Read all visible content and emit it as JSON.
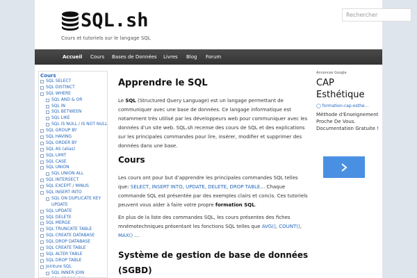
{
  "header": {
    "logo_text": "SQL.sh",
    "tagline": "Cours et tutoriels sur le langage SQL",
    "search_placeholder": "Rechercher"
  },
  "nav": [
    "Accueil",
    "Cours",
    "Bases de Données",
    "Livres",
    "Blog",
    "Forum"
  ],
  "sidebar": {
    "heading": "Cours",
    "items": [
      {
        "label": "SQL SELECT",
        "level": 1
      },
      {
        "label": "SQL DISTINCT",
        "level": 1
      },
      {
        "label": "SQL WHERE",
        "level": 1
      },
      {
        "label": "SQL AND & OR",
        "level": 2
      },
      {
        "label": "SQL IN",
        "level": 2
      },
      {
        "label": "SQL BETWEEN",
        "level": 2
      },
      {
        "label": "SQL LIKE",
        "level": 2
      },
      {
        "label": "SQL IS NULL / IS NOT NULL",
        "level": 2
      },
      {
        "label": "SQL GROUP BY",
        "level": 1
      },
      {
        "label": "SQL HAVING",
        "level": 1
      },
      {
        "label": "SQL ORDER BY",
        "level": 1
      },
      {
        "label": "SQL AS (alias)",
        "level": 1
      },
      {
        "label": "SQL LIMIT",
        "level": 1
      },
      {
        "label": "SQL CASE",
        "level": 1
      },
      {
        "label": "SQL UNION",
        "level": 1
      },
      {
        "label": "SQL UNION ALL",
        "level": 2
      },
      {
        "label": "SQL INTERSECT",
        "level": 1
      },
      {
        "label": "SQL EXCEPT / MINUS",
        "level": 1
      },
      {
        "label": "SQL INSERT INTO",
        "level": 1
      },
      {
        "label": "SQL ON DUPLICATE KEY",
        "level": 2
      },
      {
        "label": "UPDATE",
        "level": 3
      },
      {
        "label": "SQL UPDATE",
        "level": 1
      },
      {
        "label": "SQL DELETE",
        "level": 1
      },
      {
        "label": "SQL MERGE",
        "level": 1
      },
      {
        "label": "SQL TRUNCATE TABLE",
        "level": 1
      },
      {
        "label": "SQL CREATE DATABASE",
        "level": 1
      },
      {
        "label": "SQL DROP DATABASE",
        "level": 1
      },
      {
        "label": "SQL CREATE TABLE",
        "level": 1
      },
      {
        "label": "SQL ALTER TABLE",
        "level": 1
      },
      {
        "label": "SQL DROP TABLE",
        "level": 1
      },
      {
        "label": "Jointure SQL",
        "level": 1
      },
      {
        "label": "SQL INNER JOIN",
        "level": 2
      },
      {
        "label": "SQL CROSS JOIN",
        "level": 2
      }
    ]
  },
  "content": {
    "title": "Apprendre le SQL",
    "intro": {
      "p1": "Le ",
      "b1": "SQL",
      "p2": " (Structured Query Language) est un langage permettant de communiquer avec une base de données. Ce langage informatique est notamment très utilisé par les développeurs web pour communiquer avec les données d’un site web. SQL.sh recense des cours de SQL et des explications sur les principales commandes pour lire, insérer, modifier et supprimer des données dans une base."
    },
    "cours_title": "Cours",
    "cours_p": {
      "t1": "Les cours ont pour but d’apprendre les principales commandes SQL telles que: ",
      "l1": "SELECT",
      "s1": ", ",
      "l2": "INSERT INTO",
      "s2": ", ",
      "l3": "UPDATE",
      "s3": ", ",
      "l4": "DELETE",
      "s4": ", ",
      "l5": "DROP TABLE",
      "t2": "… Chaque commande SQL est présentée par des exemples clairs et concis. Ces tutoriels peuvent vous aider à faire votre propre ",
      "b1": "formation SQL",
      "t3": "."
    },
    "fiches_p": {
      "t1": "En plus de la liste des commandes SQL, les cours présentes des fiches mnémotechniques présentant les fonctions SQL telles que ",
      "l1": "AVG()",
      "s1": ", ",
      "l2": "COUNT()",
      "s2": ",",
      "l3": "MAX()",
      "t2": " …"
    },
    "sgbd_title": "Système de gestion de base de données (SGBD)"
  },
  "ad": {
    "label": "Annonces Google",
    "title": "CAP Esthétique",
    "url": "formation-cap-esthe…",
    "desc": "Méthode d'Enseignement Proche De Vous. Documentation Gratuite !"
  },
  "colors": {
    "link": "#2266bb",
    "navbar": "#3d3d3d",
    "ad_button": "#4a90e2",
    "background": "#dfe5ec"
  }
}
